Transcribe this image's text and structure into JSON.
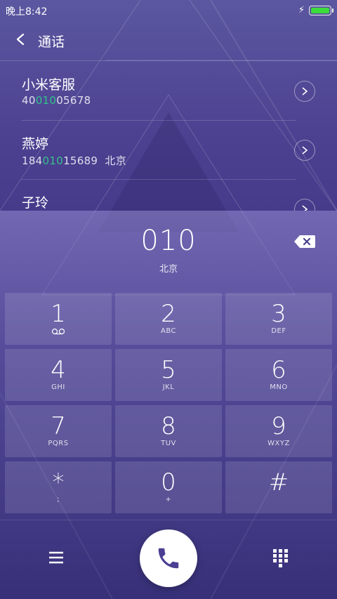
{
  "status_bar": {
    "time": "晚上8:42",
    "battery_level": 1.0,
    "charging_icon": "bolt-icon"
  },
  "header": {
    "title": "通话",
    "back_icon": "back-arrow-icon"
  },
  "contacts": [
    {
      "name": "小米客服",
      "number_before": "40",
      "number_match": "010",
      "number_after": "05678",
      "location": ""
    },
    {
      "name": "燕婷",
      "number_before": "184",
      "number_match": "010",
      "number_after": "15689",
      "location": "北京"
    },
    {
      "name": "子玲",
      "number_before": "",
      "number_match": "",
      "number_after": "",
      "location": ""
    }
  ],
  "dialer": {
    "dialed_number": "010",
    "location": "北京",
    "backspace_icon": "backspace-icon",
    "keys": [
      {
        "digit": "1",
        "letters": "",
        "icon": "voicemail-icon"
      },
      {
        "digit": "2",
        "letters": "ABC"
      },
      {
        "digit": "3",
        "letters": "DEF"
      },
      {
        "digit": "4",
        "letters": "GHI"
      },
      {
        "digit": "5",
        "letters": "JKL"
      },
      {
        "digit": "6",
        "letters": "MNO"
      },
      {
        "digit": "7",
        "letters": "PQRS"
      },
      {
        "digit": "8",
        "letters": "TUV"
      },
      {
        "digit": "9",
        "letters": "WXYZ"
      },
      {
        "digit": "*",
        "letters": ";"
      },
      {
        "digit": "0",
        "letters": "+"
      },
      {
        "digit": "#",
        "letters": ""
      }
    ]
  },
  "bottom_bar": {
    "menu_icon": "menu-icon",
    "call_icon": "phone-icon",
    "keypad_icon": "keypad-icon"
  },
  "colors": {
    "match_highlight": "#33c28a",
    "battery": "#3bdc3b"
  }
}
